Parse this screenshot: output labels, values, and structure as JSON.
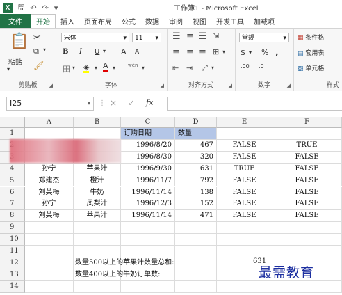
{
  "app": {
    "window_title": "工作簿1 - Microsoft Excel",
    "logo_text": "X",
    "accent": "#217346"
  },
  "tabs": [
    "文件",
    "开始",
    "插入",
    "页面布局",
    "公式",
    "数据",
    "审阅",
    "视图",
    "开发工具",
    "加载项"
  ],
  "ribbon": {
    "clipboard": {
      "label": "剪贴板",
      "paste": "粘贴"
    },
    "font": {
      "label": "字体",
      "name": "宋体",
      "size": "11",
      "bold": "B",
      "italic": "I",
      "underline": "U",
      "grow": "A",
      "shrink": "A",
      "color_a": "A",
      "phonetic": "wén"
    },
    "alignment": {
      "label": "对齐方式"
    },
    "number": {
      "label": "数字",
      "format": "常规",
      "currency": "$",
      "percent": "%",
      "comma": ",",
      "inc": ".00",
      "dec": ".0"
    },
    "styles": {
      "label": "样式",
      "conditional": "条件格",
      "table": "套用表",
      "cell": "单元格"
    }
  },
  "formula_bar": {
    "name_box": "I25",
    "cancel": "×",
    "confirm": "✓",
    "fx": "fx",
    "formula": ""
  },
  "columns": [
    "A",
    "B",
    "C",
    "D",
    "E",
    "F"
  ],
  "rows": [
    "1",
    "2",
    "3",
    "4",
    "5",
    "6",
    "7",
    "8",
    "9",
    "10",
    "11",
    "12",
    "13",
    "14"
  ],
  "header_row": {
    "c": "订购日期",
    "d": "数量"
  },
  "data": [
    {
      "a": "",
      "b": "",
      "c": "1996/8/20",
      "d": "467",
      "e": "FALSE",
      "f": "TRUE"
    },
    {
      "a": "",
      "b": "",
      "c": "1996/8/30",
      "d": "320",
      "e": "FALSE",
      "f": "FALSE"
    },
    {
      "a": "孙宁",
      "b": "苹果汁",
      "c": "1996/9/30",
      "d": "631",
      "e": "TRUE",
      "f": "FALSE"
    },
    {
      "a": "郑建杰",
      "b": "橙汁",
      "c": "1996/11/7",
      "d": "792",
      "e": "FALSE",
      "f": "FALSE"
    },
    {
      "a": "刘英梅",
      "b": "牛奶",
      "c": "1996/11/14",
      "d": "138",
      "e": "FALSE",
      "f": "FALSE"
    },
    {
      "a": "孙宁",
      "b": "凤梨汁",
      "c": "1996/12/3",
      "d": "152",
      "e": "FALSE",
      "f": "FALSE"
    },
    {
      "a": "刘英梅",
      "b": "苹果汁",
      "c": "1996/11/14",
      "d": "471",
      "e": "FALSE",
      "f": "FALSE"
    }
  ],
  "summary": {
    "q1": "数量500以上的苹果汁数量总和:",
    "a1": "631",
    "q2": "数量400以上的牛奶订单数:",
    "a2": ""
  },
  "watermark": "最需教育"
}
